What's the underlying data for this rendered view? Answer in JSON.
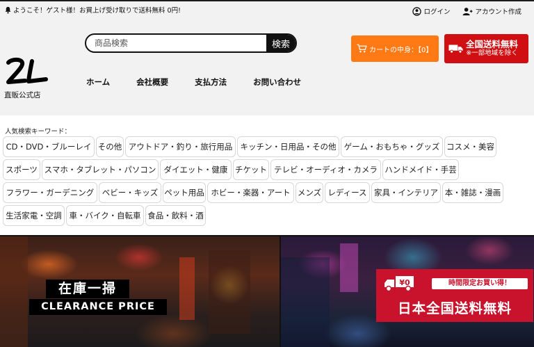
{
  "header": {
    "welcome_text": "ようこそ！ゲスト様！お買上げ受け取りで送料無料 0円!",
    "login_label": "ログイン",
    "create_account_label": "アカウント作成",
    "search_placeholder": "商品検索",
    "search_button": "検索",
    "cart_label": "カートの中身：【0】",
    "shipping_main": "全国送料無料",
    "shipping_sub": "※一部地域を除く",
    "logo_text": "直販公式店",
    "nav": [
      "ホーム",
      "会社概要",
      "支払方法",
      "お問い合わせ"
    ]
  },
  "keywords": {
    "label": "人気検索キーワード：",
    "items": [
      "CD・DVD・ブルーレイ",
      "その他",
      "アウトドア・釣り・旅行用品",
      "キッチン・日用品・その他",
      "ゲーム・おもちゃ・グッズ",
      "コスメ・美容",
      "スポーツ",
      "スマホ・タブレット・パソコン",
      "ダイエット・健康",
      "チケット",
      "テレビ・オーディオ・カメラ",
      "ハンドメイド・手芸",
      "フラワー・ガーデニング",
      "ベビー・キッズ",
      "ペット用品",
      "ホビー・楽器・アート",
      "メンズ",
      "レディース",
      "家具・インテリア",
      "本・雑誌・漫画",
      "生活家電・空調",
      "車・バイク・自転車",
      "食品・飲料・酒"
    ]
  },
  "banners": {
    "left_line1": "在庫一掃",
    "left_line2": "CLEARANCE PRICE",
    "right_tag": "時間限定お買い得！",
    "right_main": "日本全国送料無料",
    "right_yen": "¥0"
  },
  "colors": {
    "cart_orange": "#ff7a14",
    "shipping_red": "#d00f12",
    "promo_red": "#c9122c"
  }
}
